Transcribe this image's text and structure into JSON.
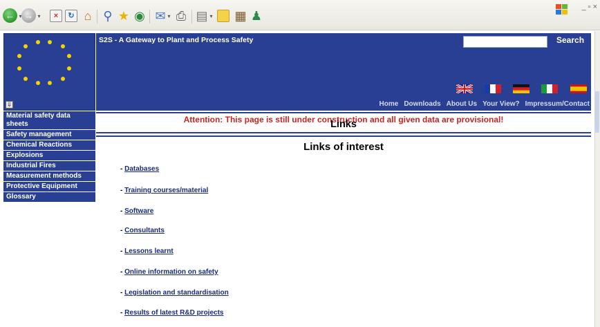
{
  "browser": {
    "toolbar_icons": [
      "back-icon",
      "forward-icon",
      "stop-icon",
      "refresh-icon",
      "home-icon",
      "search-icon",
      "favorites-icon",
      "history-icon",
      "mail-icon",
      "print-icon",
      "edit-icon",
      "messenger-icon",
      "research-icon"
    ],
    "window_controls": "_ ▫ ×"
  },
  "site": {
    "title": "S2S - A Gateway to Plant and Process Safety",
    "search": {
      "button": "Search",
      "value": ""
    },
    "languages": [
      "flag-uk-icon",
      "flag-france-icon",
      "flag-germany-icon",
      "flag-italy-icon",
      "flag-spain-icon"
    ],
    "nav": [
      "Home",
      "Downloads",
      "About Us",
      "Your View?",
      "Impressum/Contact"
    ],
    "brand_color": "#283f94"
  },
  "sidebar": {
    "items": [
      "Material safety data sheets",
      "Safety management",
      "Chemical Reactions",
      "Explosions",
      "Industrial Fires",
      "Measurement methods",
      "Protective Equipment",
      "Glossary"
    ]
  },
  "main": {
    "notice": "Attention: This page is still under construction and all given data are provisional!",
    "page_title": "Links",
    "section_title": "Links of interest",
    "links": [
      "Databases",
      "Training courses/material",
      "Software",
      "Consultants",
      "Lessons learnt",
      "Online information on safety",
      "Legislation and standardisation",
      "Results of latest R&D projects"
    ]
  }
}
